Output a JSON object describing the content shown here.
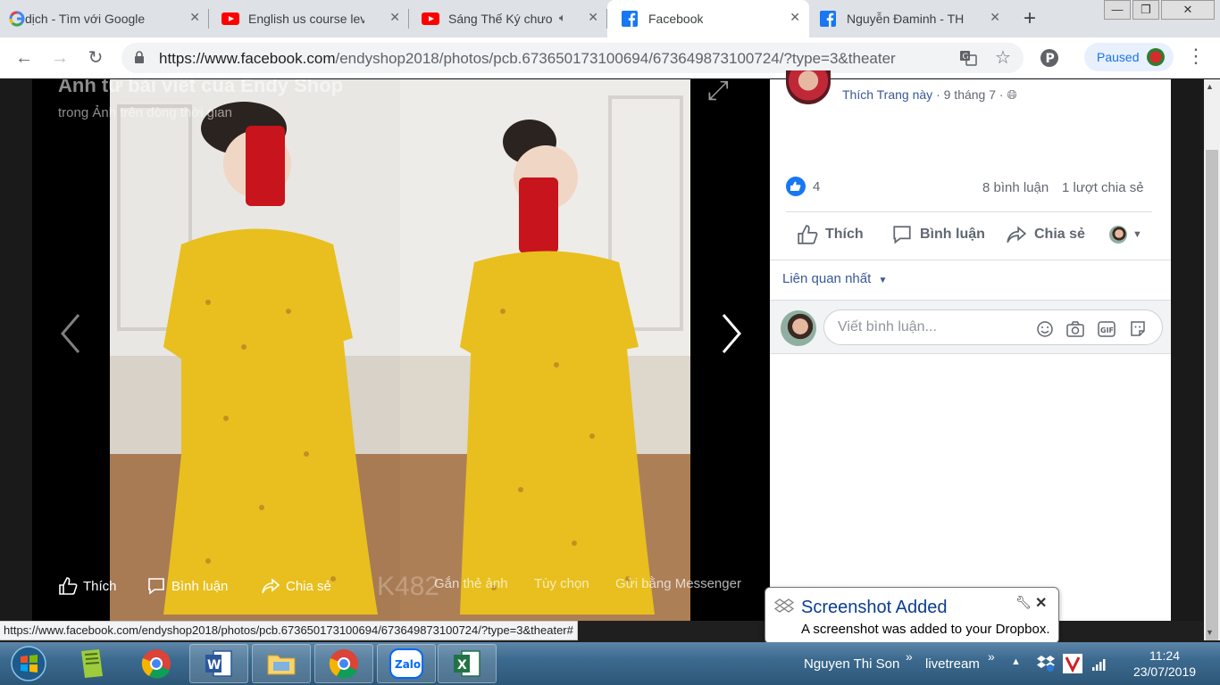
{
  "browser": {
    "tabs": [
      {
        "title": "dịch - Tìm với Google",
        "icon": "google-icon"
      },
      {
        "title": "English us course leve",
        "icon": "youtube-icon"
      },
      {
        "title": "Sáng Thế Ký chươ",
        "icon": "youtube-icon"
      },
      {
        "title": "Facebook",
        "icon": "facebook-icon",
        "active": true
      },
      {
        "title": "Nguyễn Đaminh - TH",
        "icon": "facebook-icon"
      }
    ],
    "url_host": "https://www.facebook.com",
    "url_path": "/endyshop2018/photos/pcb.673650173100694/673649873100724/?type=3&theater",
    "profile_status": "Paused",
    "status_url": "https://www.facebook.com/endyshop2018/photos/pcb.673650173100694/673649873100724/?type=3&theater#"
  },
  "theater": {
    "title": "Ảnh từ bài viết của Endy Shop",
    "subtitle": "trong Ảnh trên dòng thời gian",
    "watermark": "K482",
    "actions": {
      "like": "Thích",
      "comment": "Bình luận",
      "share": "Chia sẻ",
      "tag": "Gắn thẻ ảnh",
      "options": "Tùy chọn",
      "messenger": "Gửi bằng Messenger"
    }
  },
  "post": {
    "like_page": "Thích Trang này",
    "date": "9 tháng 7",
    "separator": "·",
    "reaction_count": "4",
    "comment_count": "8 bình luận",
    "share_count": "1 lượt chia sẻ",
    "actions": {
      "like": "Thích",
      "comment": "Bình luận",
      "share": "Chia sẻ"
    },
    "sort_label": "Liên quan nhất",
    "comment_placeholder": "Viết bình luận..."
  },
  "dropbox": {
    "title": "Screenshot Added",
    "message": "A screenshot was added to your Dropbox."
  },
  "taskbar": {
    "toolbars": [
      "Nguyen Thi Son",
      "livetream"
    ],
    "time": "11:24",
    "date": "23/07/2019"
  },
  "colors": {
    "facebook_blue": "#385898",
    "like_blue": "#1877f2",
    "dress_yellow": "#e8bf1e",
    "dropbox_title": "#0b3d91"
  }
}
